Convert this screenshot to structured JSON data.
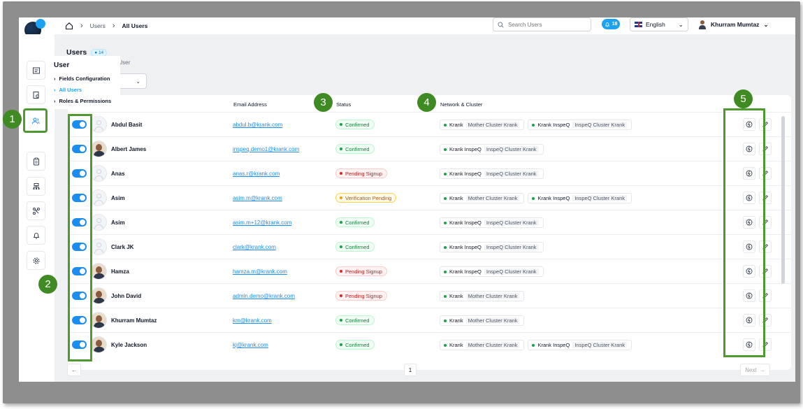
{
  "breadcrumb": {
    "items": [
      "Users",
      "All Users"
    ]
  },
  "search": {
    "placeholder": "Search Users"
  },
  "notifications": {
    "count": "18"
  },
  "language": {
    "selected": "English"
  },
  "user_menu": {
    "name": "Khurram Mumtaz"
  },
  "page": {
    "title": "Users",
    "count": "14",
    "subtitle_partial": "re User"
  },
  "flyout": {
    "title": "User",
    "items": [
      "Fields Configuration",
      "All Users",
      "Roles & Permissions"
    ]
  },
  "table": {
    "columns": {
      "email": "Email Address",
      "status": "Status",
      "network": "Network & Cluster"
    },
    "rows": [
      {
        "name": "Abdul Basit",
        "email": "abdul.b@krank.com",
        "status": "Confirmed",
        "networks": [
          [
            "Krank",
            "Mother Cluster Krank"
          ],
          [
            "Krank InspeQ",
            "InspeQ Cluster Krank"
          ]
        ]
      },
      {
        "name": "Albert James",
        "email": "inspeq.demo1@krank.com",
        "status": "Confirmed",
        "networks": [
          [
            "Krank InspeQ",
            "InspeQ Cluster Krank"
          ]
        ]
      },
      {
        "name": "Anas",
        "email": "anas.r@krank.com",
        "status": "Pending Signup",
        "networks": [
          [
            "Krank InspeQ",
            "InspeQ Cluster Krank"
          ]
        ]
      },
      {
        "name": "Asim",
        "email": "asim.m@krank.com",
        "status": "Verification Pending",
        "networks": [
          [
            "Krank",
            "Mother Cluster Krank"
          ],
          [
            "Krank InspeQ",
            "InspeQ Cluster Krank"
          ]
        ]
      },
      {
        "name": "Asim",
        "email": "asim.m+12@krank.com",
        "status": "Confirmed",
        "networks": [
          [
            "Krank InspeQ",
            "InspeQ Cluster Krank"
          ]
        ]
      },
      {
        "name": "Clark JK",
        "email": "clark@krank.com",
        "status": "Confirmed",
        "networks": [
          [
            "Krank InspeQ",
            "InspeQ Cluster Krank"
          ]
        ]
      },
      {
        "name": "Hamza",
        "email": "hamza.m@krank.com",
        "status": "Pending Signup",
        "networks": [
          [
            "Krank InspeQ",
            "InspeQ Cluster Krank"
          ]
        ]
      },
      {
        "name": "John David",
        "email": "admin.demo@krank.com",
        "status": "Pending Signup",
        "networks": [
          [
            "Krank",
            "Mother Cluster Krank"
          ]
        ]
      },
      {
        "name": "Khurram Mumtaz",
        "email": "km@krank.com",
        "status": "Confirmed",
        "networks": [
          [
            "Krank",
            "Mother Cluster Krank"
          ]
        ]
      },
      {
        "name": "Kyle Jackson",
        "email": "kj@krank.com",
        "status": "Confirmed",
        "networks": [
          [
            "Krank",
            "Mother Cluster Krank"
          ],
          [
            "Krank InspeQ",
            "InspeQ Cluster Krank"
          ]
        ]
      }
    ]
  },
  "pagination": {
    "current": "1",
    "next_label": "Next"
  },
  "callouts": [
    "1",
    "2",
    "3",
    "4",
    "5"
  ],
  "colors": {
    "accent": "#1d8cf0",
    "callout": "#4e9a2e"
  }
}
